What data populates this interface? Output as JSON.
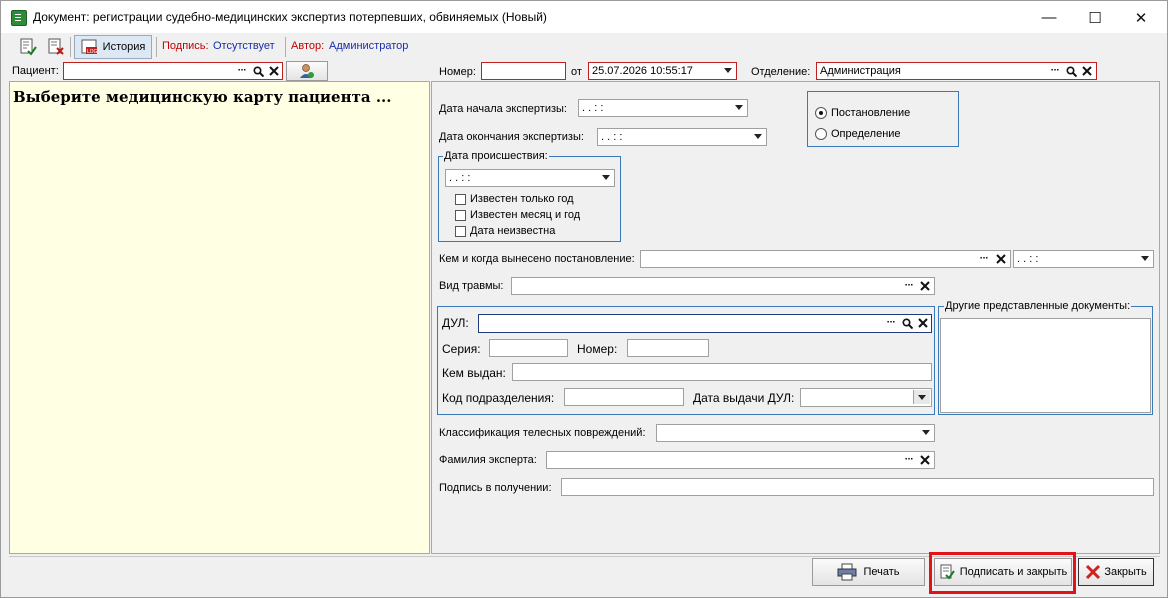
{
  "window": {
    "title": "Документ: регистрации судебно-медицинских экспертиз потерпевших, обвиняемых (Новый)",
    "minimize": "—",
    "maximize": "☐",
    "close": "✕"
  },
  "toolbar": {
    "history_label": "История",
    "sign_label": "Подпись:",
    "sign_value": "Отсутствует",
    "author_label": "Автор:",
    "author_value": "Администратор"
  },
  "header": {
    "patient_label": "Пациент:",
    "patient_value": "",
    "number_label": "Номер:",
    "number_value": "",
    "from_label": "от",
    "date_value": "25.07.2026 10:55:17",
    "department_label": "Отделение:",
    "department_value": "Администрация"
  },
  "patient_panel": {
    "message": "Выберите медицинскую карту пациента ..."
  },
  "form": {
    "exam_start_label": "Дата начала экспертизы:",
    "exam_start_value": " .  .      :  :",
    "exam_end_label": "Дата окончания экспертизы:",
    "exam_end_value": " .  .      :  :",
    "incident_group": "Дата происшествия:",
    "incident_value": " .  .      :  :",
    "only_year": "Известен только год",
    "month_year": "Известен месяц и год",
    "date_unknown": "Дата неизвестна",
    "radio_resolution": "Постановление",
    "radio_determination": "Определение",
    "who_when_label": "Кем и когда вынесено постановление:",
    "who_when_date": " .  .      :  :",
    "injury_type_label": "Вид травмы:",
    "doc_label": "ДУЛ:",
    "series_label": "Серия:",
    "doc_number_label": "Номер:",
    "issued_by_label": "Кем выдан:",
    "subdivision_code_label": "Код подразделения:",
    "issue_date_label": "Дата выдачи ДУЛ:",
    "other_docs_group": "Другие представленные документы:",
    "classification_label": "Классификация телесных повреждений:",
    "expert_label": "Фамилия эксперта:",
    "receipt_sign_label": "Подпись в получении:"
  },
  "buttons": {
    "print": "Печать",
    "sign_close": "Подписать и закрыть",
    "close": "Закрыть"
  },
  "colors": {
    "patient_panel_bg": "#ffffe3",
    "required_border": "#c02020",
    "group_border": "#3a78b8",
    "highlight": "#e0121a"
  }
}
